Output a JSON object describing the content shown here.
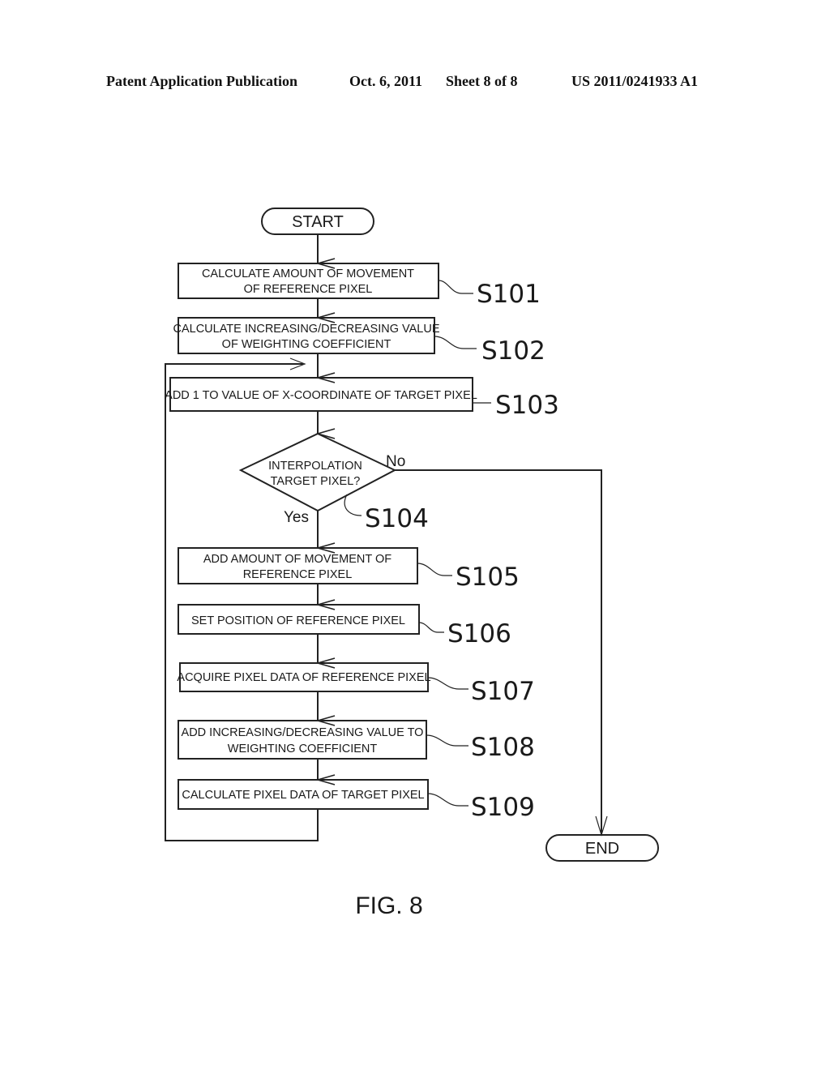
{
  "header": {
    "publication": "Patent Application Publication",
    "date": "Oct. 6, 2011",
    "sheet": "Sheet 8 of 8",
    "number": "US 2011/0241933 A1"
  },
  "flowchart": {
    "start": "START",
    "end": "END",
    "steps": [
      {
        "id": "S101",
        "lines": [
          "CALCULATE AMOUNT OF MOVEMENT",
          "OF REFERENCE PIXEL"
        ]
      },
      {
        "id": "S102",
        "lines": [
          "CALCULATE INCREASING/DECREASING VALUE",
          "OF WEIGHTING COEFFICIENT"
        ]
      },
      {
        "id": "S103",
        "lines": [
          "ADD 1  TO VALUE OF X-COORDINATE OF TARGET PIXEL"
        ]
      },
      {
        "id": "S104",
        "lines": [
          "INTERPOLATION",
          "TARGET PIXEL?"
        ]
      },
      {
        "id": "S105",
        "lines": [
          "ADD AMOUNT OF MOVEMENT OF",
          "REFERENCE PIXEL"
        ]
      },
      {
        "id": "S106",
        "lines": [
          "SET POSITION OF REFERENCE PIXEL"
        ]
      },
      {
        "id": "S107",
        "lines": [
          "ACQUIRE PIXEL DATA OF REFERENCE PIXEL"
        ]
      },
      {
        "id": "S108",
        "lines": [
          "ADD INCREASING/DECREASING VALUE TO",
          "WEIGHTING COEFFICIENT"
        ]
      },
      {
        "id": "S109",
        "lines": [
          "CALCULATE PIXEL DATA OF TARGET PIXEL"
        ]
      }
    ],
    "decision_yes": "Yes",
    "decision_no": "No"
  },
  "figure_label": "FIG. 8"
}
